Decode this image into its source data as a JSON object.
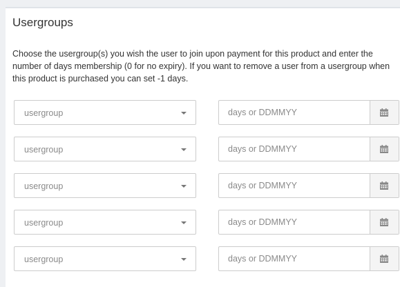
{
  "section": {
    "title": "Usergroups",
    "description": "Choose the usergroup(s) you wish the user to join upon payment for this product and enter the number of days membership (0 for no expiry). If you want to remove a user from a usergroup when this product is purchased you can set -1 days."
  },
  "rows": [
    {
      "usergroup_placeholder": "usergroup",
      "days_placeholder": "days or DDMMYY"
    },
    {
      "usergroup_placeholder": "usergroup",
      "days_placeholder": "days or DDMMYY"
    },
    {
      "usergroup_placeholder": "usergroup",
      "days_placeholder": "days or DDMMYY"
    },
    {
      "usergroup_placeholder": "usergroup",
      "days_placeholder": "days or DDMMYY"
    },
    {
      "usergroup_placeholder": "usergroup",
      "days_placeholder": "days or DDMMYY"
    }
  ],
  "icons": {
    "dropdown": "chevron-down-icon",
    "calendar": "calendar-icon"
  },
  "colors": {
    "text": "#333333",
    "placeholder": "#8a8a8a",
    "border": "#cccccc",
    "addon_bg": "#f4f4f4"
  }
}
